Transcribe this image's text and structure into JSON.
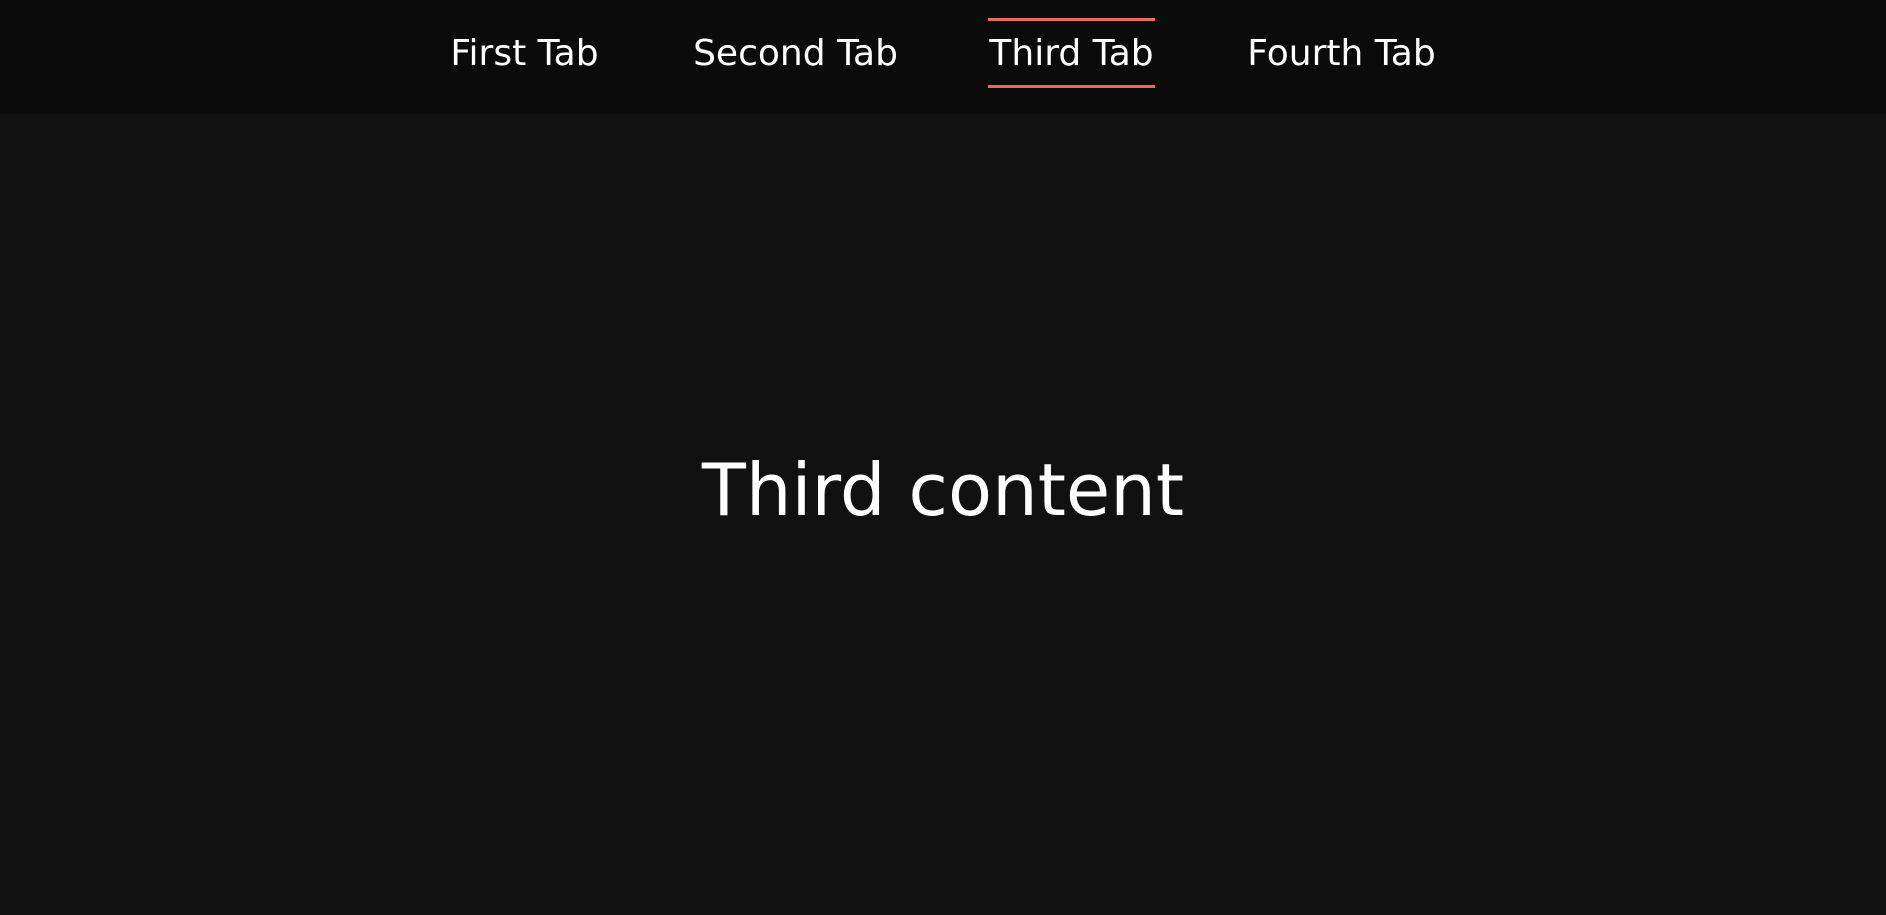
{
  "tabs": [
    {
      "label": "First Tab",
      "active": false
    },
    {
      "label": "Second Tab",
      "active": false
    },
    {
      "label": "Third Tab",
      "active": true
    },
    {
      "label": "Fourth Tab",
      "active": false
    }
  ],
  "content": {
    "text": "Third content"
  },
  "colors": {
    "background": "#121112",
    "tab_bar_background": "#0b0b0c",
    "active_tab_accent": "#e8686b",
    "text": "#ffffff"
  }
}
